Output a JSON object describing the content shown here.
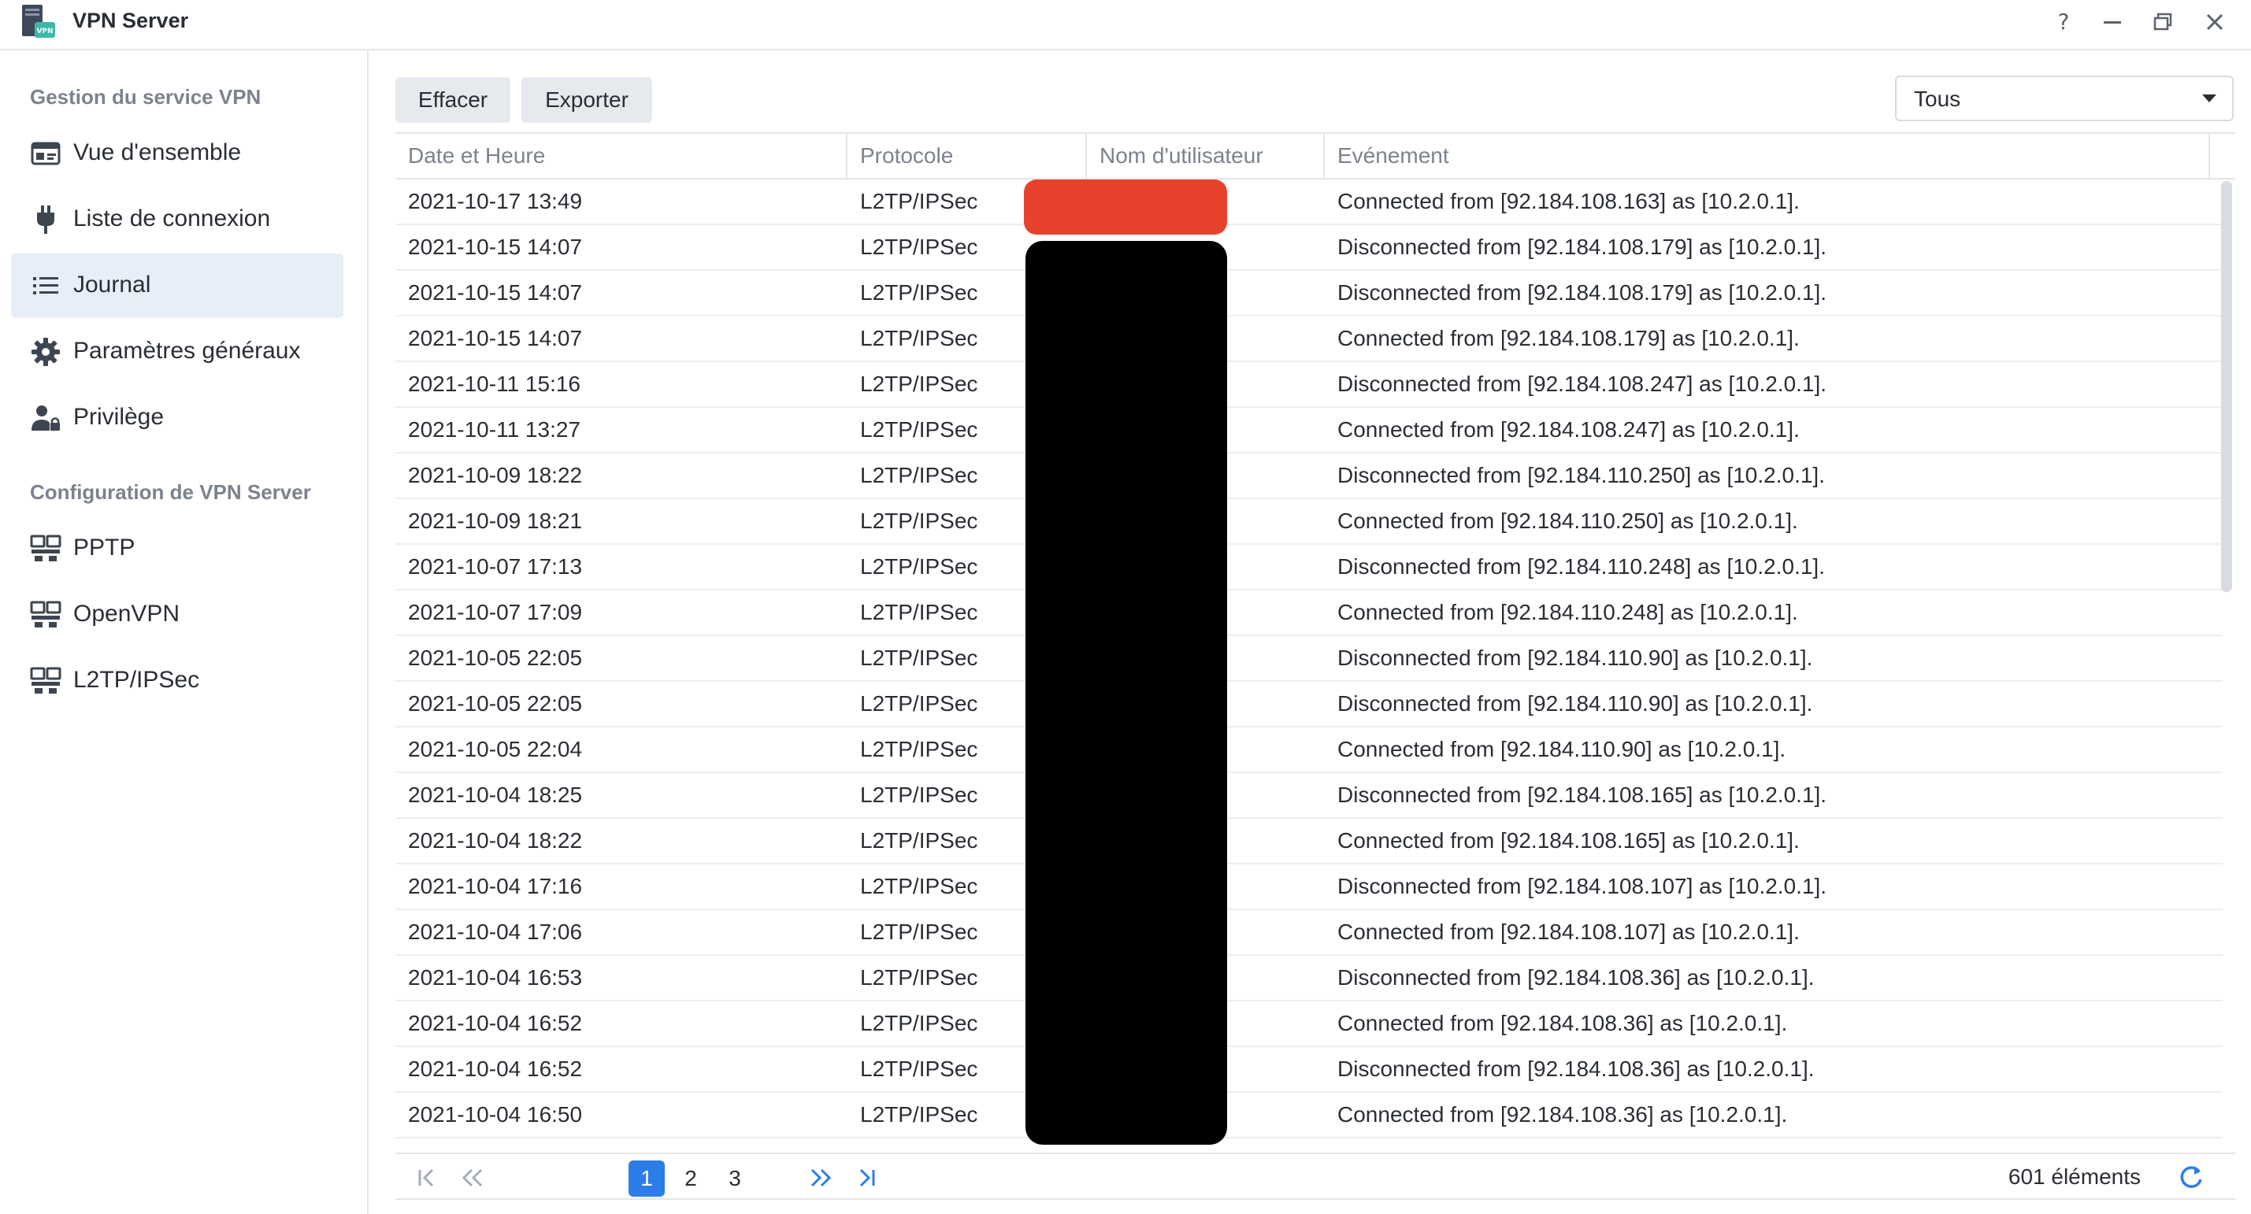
{
  "window": {
    "title": "VPN Server",
    "app_icon": "vpn-server-icon",
    "controls": [
      "help-icon",
      "minimize-icon",
      "restore-icon",
      "close-icon"
    ]
  },
  "sidebar": {
    "section_service": "Gestion du service VPN",
    "section_config": "Configuration de VPN Server",
    "items": [
      {
        "label": "Vue d'ensemble",
        "icon": "overview-icon"
      },
      {
        "label": "Liste de connexion",
        "icon": "plug-icon"
      },
      {
        "label": "Journal",
        "icon": "list-icon",
        "active": true
      },
      {
        "label": "Paramètres généraux",
        "icon": "gear-icon"
      },
      {
        "label": "Privilège",
        "icon": "user-lock-icon"
      },
      {
        "label": "PPTP",
        "icon": "network-icon"
      },
      {
        "label": "OpenVPN",
        "icon": "network-icon"
      },
      {
        "label": "L2TP/IPSec",
        "icon": "network-icon"
      }
    ]
  },
  "toolbar": {
    "clear_label": "Effacer",
    "export_label": "Exporter",
    "filter_value": "Tous"
  },
  "table": {
    "columns": [
      "Date et Heure",
      "Protocole",
      "Nom d'utilisateur",
      "Evénement"
    ],
    "rows": [
      {
        "date": "2021-10-17 13:49",
        "protocol": "L2TP/IPSec",
        "user": "",
        "event": "Connected from [92.184.108.163] as [10.2.0.1]."
      },
      {
        "date": "2021-10-15 14:07",
        "protocol": "L2TP/IPSec",
        "user": "",
        "event": "Disconnected from [92.184.108.179] as [10.2.0.1]."
      },
      {
        "date": "2021-10-15 14:07",
        "protocol": "L2TP/IPSec",
        "user": "",
        "event": "Disconnected from [92.184.108.179] as [10.2.0.1]."
      },
      {
        "date": "2021-10-15 14:07",
        "protocol": "L2TP/IPSec",
        "user": "",
        "event": "Connected from [92.184.108.179] as [10.2.0.1]."
      },
      {
        "date": "2021-10-11 15:16",
        "protocol": "L2TP/IPSec",
        "user": "",
        "event": "Disconnected from [92.184.108.247] as [10.2.0.1]."
      },
      {
        "date": "2021-10-11 13:27",
        "protocol": "L2TP/IPSec",
        "user": "",
        "event": "Connected from [92.184.108.247] as [10.2.0.1]."
      },
      {
        "date": "2021-10-09 18:22",
        "protocol": "L2TP/IPSec",
        "user": "",
        "event": "Disconnected from [92.184.110.250] as [10.2.0.1]."
      },
      {
        "date": "2021-10-09 18:21",
        "protocol": "L2TP/IPSec",
        "user": "",
        "event": "Connected from [92.184.110.250] as [10.2.0.1]."
      },
      {
        "date": "2021-10-07 17:13",
        "protocol": "L2TP/IPSec",
        "user": "",
        "event": "Disconnected from [92.184.110.248] as [10.2.0.1]."
      },
      {
        "date": "2021-10-07 17:09",
        "protocol": "L2TP/IPSec",
        "user": "",
        "event": "Connected from [92.184.110.248] as [10.2.0.1]."
      },
      {
        "date": "2021-10-05 22:05",
        "protocol": "L2TP/IPSec",
        "user": "",
        "event": "Disconnected from [92.184.110.90] as [10.2.0.1]."
      },
      {
        "date": "2021-10-05 22:05",
        "protocol": "L2TP/IPSec",
        "user": "",
        "event": "Disconnected from [92.184.110.90] as [10.2.0.1]."
      },
      {
        "date": "2021-10-05 22:04",
        "protocol": "L2TP/IPSec",
        "user": "",
        "event": "Connected from [92.184.110.90] as [10.2.0.1]."
      },
      {
        "date": "2021-10-04 18:25",
        "protocol": "L2TP/IPSec",
        "user": "",
        "event": "Disconnected from [92.184.108.165] as [10.2.0.1]."
      },
      {
        "date": "2021-10-04 18:22",
        "protocol": "L2TP/IPSec",
        "user": "",
        "event": "Connected from [92.184.108.165] as [10.2.0.1]."
      },
      {
        "date": "2021-10-04 17:16",
        "protocol": "L2TP/IPSec",
        "user": "",
        "event": "Disconnected from [92.184.108.107] as [10.2.0.1]."
      },
      {
        "date": "2021-10-04 17:06",
        "protocol": "L2TP/IPSec",
        "user": "",
        "event": "Connected from [92.184.108.107] as [10.2.0.1]."
      },
      {
        "date": "2021-10-04 16:53",
        "protocol": "L2TP/IPSec",
        "user": "",
        "event": "Disconnected from [92.184.108.36] as [10.2.0.1]."
      },
      {
        "date": "2021-10-04 16:52",
        "protocol": "L2TP/IPSec",
        "user": "",
        "event": "Connected from [92.184.108.36] as [10.2.0.1]."
      },
      {
        "date": "2021-10-04 16:52",
        "protocol": "L2TP/IPSec",
        "user": "",
        "event": "Disconnected from [92.184.108.36] as [10.2.0.1]."
      },
      {
        "date": "2021-10-04 16:50",
        "protocol": "L2TP/IPSec",
        "user": "",
        "event": "Connected from [92.184.108.36] as [10.2.0.1]."
      }
    ]
  },
  "pager": {
    "pages": [
      "1",
      "2",
      "3"
    ],
    "current_page": "1",
    "count_label": "601 éléments",
    "icons": [
      "first-page-icon",
      "prev-page-icon",
      "next-page-icon",
      "last-page-icon",
      "refresh-icon"
    ]
  },
  "colors": {
    "accent": "#2d7de8",
    "active_nav_bg": "#e7eef8",
    "redaction_red": "#e8412c",
    "redaction_black": "#000000"
  }
}
